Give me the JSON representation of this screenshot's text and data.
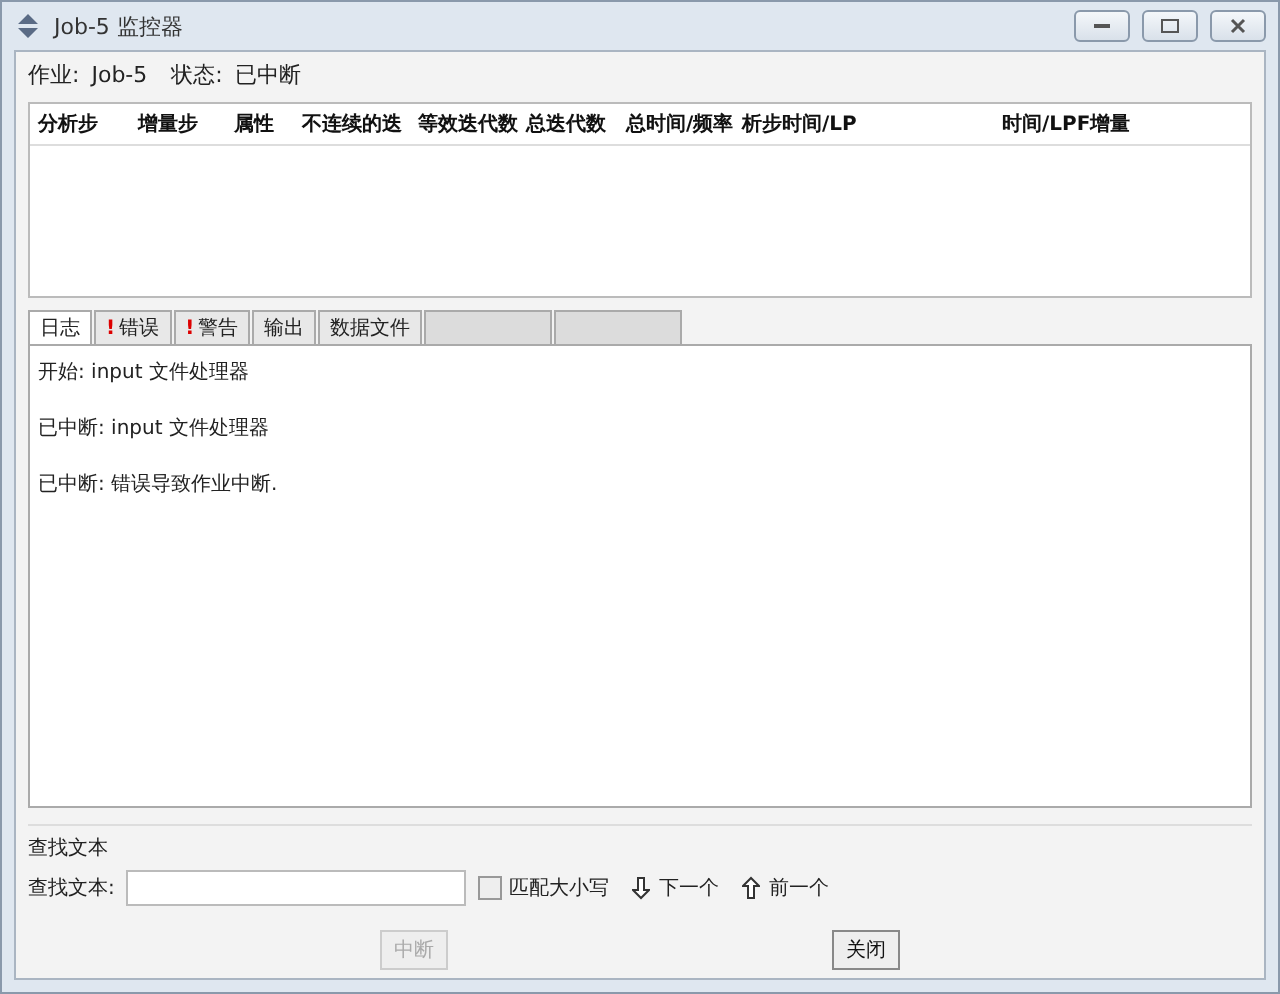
{
  "window": {
    "title": "Job-5 监控器"
  },
  "job": {
    "label": "作业:",
    "value": "Job-5",
    "status_label": "状态:",
    "status": "已中断"
  },
  "table": {
    "columns": [
      "分析步",
      "增量步",
      "属性",
      "不连续的迭",
      "等效迭代数",
      "总迭代数",
      "总时间/频率",
      "析步时间/LP",
      "时间/LPF增量"
    ]
  },
  "tabs": [
    {
      "label": "日志",
      "selected": true,
      "disabled": false
    },
    {
      "label": "错误",
      "selected": false,
      "marker": "!",
      "disabled": false
    },
    {
      "label": "警告",
      "selected": false,
      "marker": "!",
      "disabled": false
    },
    {
      "label": "输出",
      "selected": false,
      "disabled": false
    },
    {
      "label": "数据文件",
      "selected": false,
      "disabled": false
    },
    {
      "selected": false,
      "disabled": true
    },
    {
      "selected": false,
      "disabled": true
    }
  ],
  "log": [
    "开始:  input 文件处理器",
    "已中断:  input 文件处理器",
    "已中断:  错误导致作业中断."
  ],
  "find": {
    "section_title": "查找文本",
    "label": "查找文本:",
    "match_case": {
      "label": "匹配大小写",
      "checked": false
    },
    "next": "下一个",
    "previous": "前一个"
  },
  "buttons": [
    {
      "label": "中断",
      "disabled": true
    },
    {
      "label": "关闭",
      "disabled": false
    }
  ]
}
